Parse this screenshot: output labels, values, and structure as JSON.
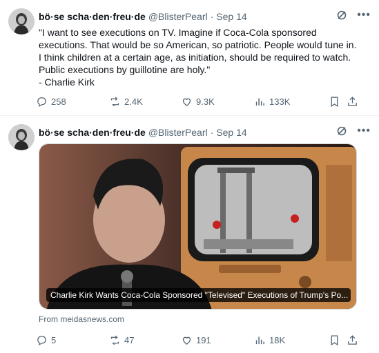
{
  "tweets": [
    {
      "author_name": "bö·se scha·den·freu·de",
      "handle": "@BlisterPearl",
      "separator": "·",
      "time": "Sep 14",
      "text_lines": [
        "\"I want to see executions on TV. Imagine if Coca-Cola sponsored",
        "executions. That would be so American, so patriotic. People would tune in.",
        "I think children at a certain age, as initiation, should be required to watch.",
        "Public executions by guillotine are holy.\"",
        "- Charlie Kirk"
      ],
      "stats": {
        "replies": "258",
        "reposts": "2.4K",
        "likes": "9.3K",
        "views": "133K"
      }
    },
    {
      "author_name": "bö·se scha·den·freu·de",
      "handle": "@BlisterPearl",
      "separator": "·",
      "time": "Sep 14",
      "card_title": "Charlie Kirk Wants Coca-Cola Sponsored \"Televised\" Executions of Trump's Po...",
      "source": "From meidasnews.com",
      "stats": {
        "replies": "5",
        "reposts": "47",
        "likes": "191",
        "views": "18K"
      }
    }
  ],
  "colors": {
    "secondary_text": "#536471",
    "primary_text": "#0f1419",
    "divider": "#eff3f4"
  },
  "icons": [
    "grok-icon",
    "more-icon",
    "reply-icon",
    "repost-icon",
    "like-icon",
    "views-icon",
    "bookmark-icon",
    "share-icon"
  ]
}
